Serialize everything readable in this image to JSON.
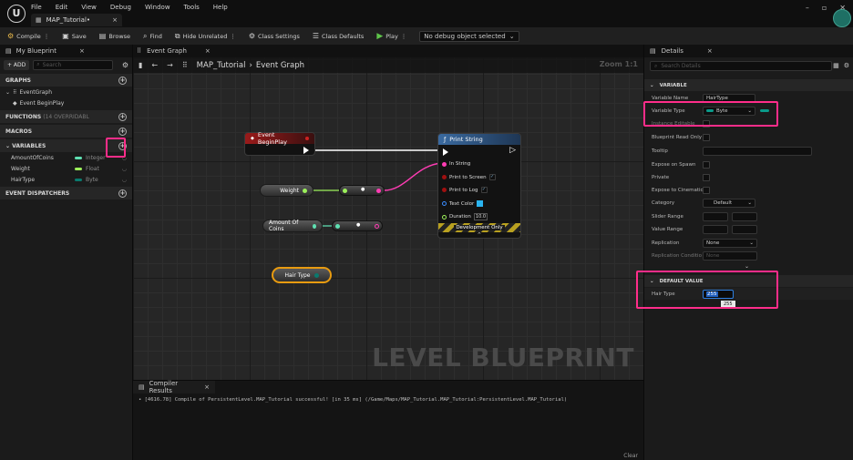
{
  "menu": [
    "File",
    "Edit",
    "View",
    "Debug",
    "Window",
    "Tools",
    "Help"
  ],
  "doc_tab": {
    "label": "MAP_Tutorial•",
    "close": "×"
  },
  "window_controls": {
    "minimize": "–",
    "restore": "▫",
    "close": "✕"
  },
  "toolbar": {
    "compile": "Compile",
    "save": "Save",
    "browse": "Browse",
    "find": "Find",
    "hide_unrelated": "Hide Unrelated",
    "class_settings": "Class Settings",
    "class_defaults": "Class Defaults",
    "play": "Play",
    "debug_object": "No debug object selected"
  },
  "my_blueprint": {
    "tab": "My Blueprint",
    "close": "×",
    "add": "+ ADD",
    "search_placeholder": "Search",
    "graphs": "GRAPHS",
    "event_graph": "EventGraph",
    "event_begin_play": "Event BeginPlay",
    "functions": "FUNCTIONS",
    "functions_overridable": "(14 OVERRIDABL",
    "macros": "MACROS",
    "variables": "VARIABLES",
    "variable_list": [
      {
        "name": "AmountOfCoins",
        "type": "Integer",
        "color": "#5fe0b2"
      },
      {
        "name": "Weight",
        "type": "Float",
        "color": "#9cf05a"
      },
      {
        "name": "HairType",
        "type": "Byte",
        "color": "#0a7a6e"
      }
    ],
    "event_dispatchers": "EVENT DISPATCHERS"
  },
  "graph": {
    "tab": "Event Graph",
    "close": "×",
    "breadcrumb_root": "MAP_Tutorial",
    "breadcrumb_sep": "›",
    "breadcrumb_leaf": "Event Graph",
    "zoom": "Zoom 1:1",
    "watermark": "LEVEL BLUEPRINT",
    "nodes": {
      "event_begin_play": "Event BeginPlay",
      "print_string": "Print String",
      "in_string": "In String",
      "print_to_screen": "Print to Screen",
      "print_to_log": "Print to Log",
      "text_color": "Text Color",
      "duration": "Duration",
      "duration_value": "10.0",
      "development_only": "Development Only",
      "weight": "Weight",
      "amount_of_coins": "Amount Of Coins",
      "hair_type": "Hair Type"
    }
  },
  "compiler": {
    "tab": "Compiler Results",
    "close": "×",
    "message": "• [4616.78] Compile of PersistentLevel.MAP_Tutorial successful! [in 35 ms] (/Game/Maps/MAP_Tutorial.MAP_Tutorial:PersistentLevel.MAP_Tutorial)",
    "clear": "Clear"
  },
  "details": {
    "tab": "Details",
    "close": "×",
    "search_placeholder": "Search Details",
    "variable_section": "VARIABLE",
    "variable_name_label": "Variable Name",
    "variable_name": "HairType",
    "variable_type_label": "Variable Type",
    "variable_type": "Byte",
    "variable_type_color": "#0a9a8a",
    "instance_editable_label": "Instance Editable",
    "blueprint_read_only_label": "Blueprint Read Only",
    "tooltip_label": "Tooltip",
    "expose_on_spawn_label": "Expose on Spawn",
    "private_label": "Private",
    "expose_to_cinematics_label": "Expose to Cinematic",
    "category_label": "Category",
    "category_value": "Default",
    "slider_range_label": "Slider Range",
    "value_range_label": "Value Range",
    "replication_label": "Replication",
    "replication_value": "None",
    "replication_condition_label": "Replication Conditio",
    "replication_condition_value": "None",
    "default_value_section": "DEFAULT VALUE",
    "hair_type_label": "Hair Type",
    "hair_type_value": "255",
    "tooltip_popup": "255"
  },
  "accent_highlight": "#ff2d8a"
}
